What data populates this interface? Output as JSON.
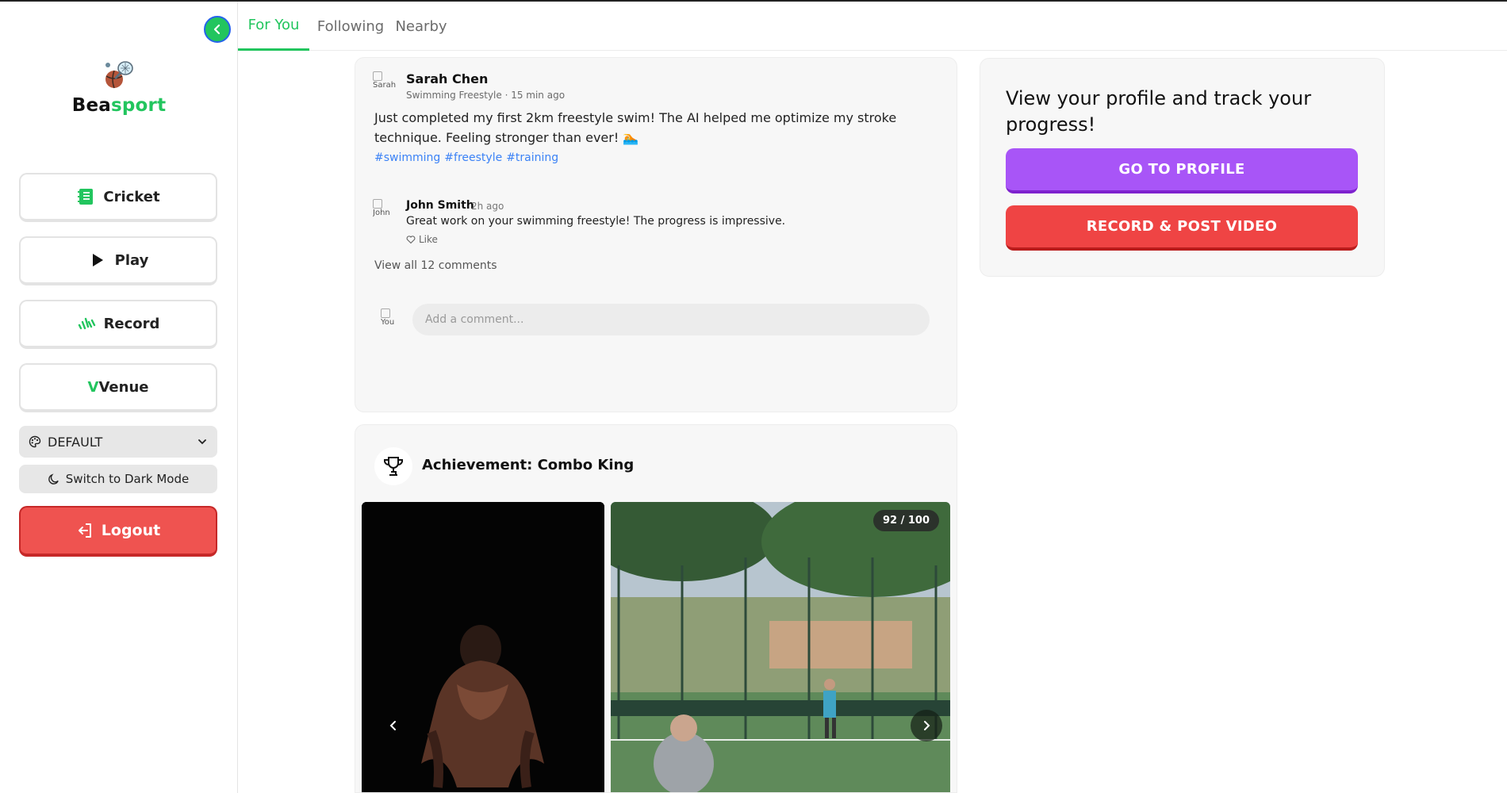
{
  "app": {
    "brand_part1": "Bea",
    "brand_part2": "sport",
    "colors": {
      "accent": "#22c55e",
      "purple": "#a855f7",
      "red": "#ef4444",
      "link": "#3b82f6"
    }
  },
  "sidebar": {
    "collapse_icon": "chevron-left-icon",
    "nav": [
      {
        "label": "Cricket",
        "icon": "notebook-icon"
      },
      {
        "label": "Play",
        "icon": "play-icon"
      },
      {
        "label": "Record",
        "icon": "soundwave-icon"
      },
      {
        "label_prefix": "V",
        "label": "Venue",
        "icon": "venue-v-icon"
      }
    ],
    "theme_select": {
      "value": "DEFAULT",
      "icon": "palette-icon"
    },
    "dark_mode_label": "Switch to Dark Mode",
    "logout_label": "Logout"
  },
  "tabs": [
    {
      "label": "For You",
      "active": true
    },
    {
      "label": "Following",
      "active": false
    },
    {
      "label": "Nearby",
      "active": false
    }
  ],
  "post": {
    "author": "Sarah Chen",
    "avatar_alt": "Sarah",
    "meta": "Swimming Freestyle · 15 min ago",
    "text": "Just completed my first 2km freestyle swim! The AI helped me optimize my stroke technique. Feeling stronger than ever! 🏊",
    "hashtags": [
      "#swimming",
      "#freestyle",
      "#training"
    ],
    "comment": {
      "author": "John Smith",
      "avatar_alt": "John",
      "time": "2h ago",
      "text": "Great work on your swimming freestyle! The progress is impressive.",
      "like_label": "Like"
    },
    "view_all_label": "View all 12 comments",
    "comment_input_placeholder": "Add a comment...",
    "my_avatar_alt": "You"
  },
  "achievement": {
    "title": "Achievement: Combo King",
    "score": "92 / 100"
  },
  "profile_panel": {
    "text": "View your profile and track your progress!",
    "go_to_profile_label": "GO TO PROFILE",
    "record_post_label": "RECORD & POST VIDEO"
  }
}
